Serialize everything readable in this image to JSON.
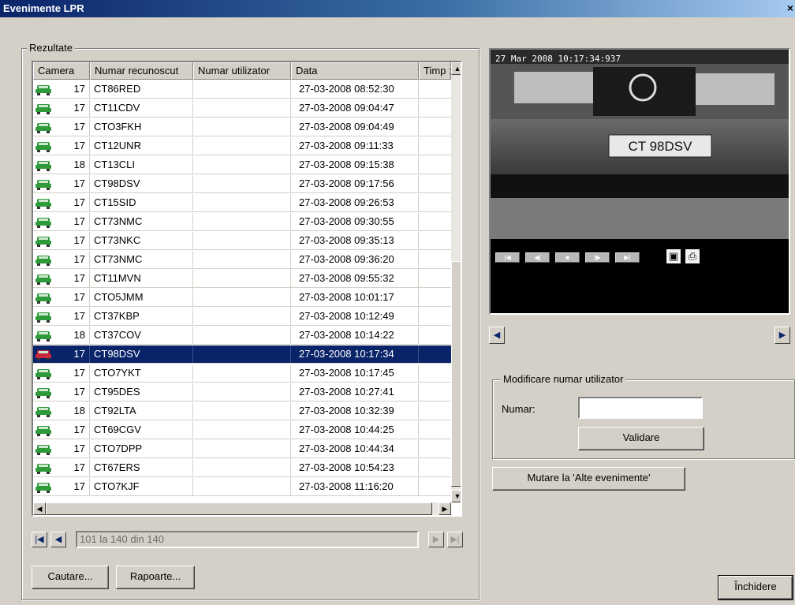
{
  "window": {
    "title": "Evenimente LPR",
    "close_glyph": "×"
  },
  "results": {
    "group_label": "Rezultate",
    "columns": [
      "Camera",
      "Numar recunoscut",
      "Numar utilizator",
      "Data",
      "Timp :"
    ],
    "rows": [
      {
        "camera": "17",
        "plate": "CT86RED",
        "user": "",
        "date": "27-03-2008 08:52:30",
        "icon": "car-icon"
      },
      {
        "camera": "17",
        "plate": "CT11CDV",
        "user": "",
        "date": "27-03-2008 09:04:47",
        "icon": "car-icon"
      },
      {
        "camera": "17",
        "plate": "CTO3FKH",
        "user": "",
        "date": "27-03-2008 09:04:49",
        "icon": "car-icon"
      },
      {
        "camera": "17",
        "plate": "CT12UNR",
        "user": "",
        "date": "27-03-2008 09:11:33",
        "icon": "car-icon"
      },
      {
        "camera": "18",
        "plate": "CT13CLI",
        "user": "",
        "date": "27-03-2008 09:15:38",
        "icon": "car-icon"
      },
      {
        "camera": "17",
        "plate": "CT98DSV",
        "user": "",
        "date": "27-03-2008 09:17:56",
        "icon": "car-icon"
      },
      {
        "camera": "17",
        "plate": "CT15SID",
        "user": "",
        "date": "27-03-2008 09:26:53",
        "icon": "car-icon"
      },
      {
        "camera": "17",
        "plate": "CT73NMC",
        "user": "",
        "date": "27-03-2008 09:30:55",
        "icon": "car-icon"
      },
      {
        "camera": "17",
        "plate": "CT73NKC",
        "user": "",
        "date": "27-03-2008 09:35:13",
        "icon": "car-icon"
      },
      {
        "camera": "17",
        "plate": "CT73NMC",
        "user": "",
        "date": "27-03-2008 09:36:20",
        "icon": "car-icon"
      },
      {
        "camera": "17",
        "plate": "CT11MVN",
        "user": "",
        "date": "27-03-2008 09:55:32",
        "icon": "car-icon"
      },
      {
        "camera": "17",
        "plate": "CTO5JMM",
        "user": "",
        "date": "27-03-2008 10:01:17",
        "icon": "car-icon"
      },
      {
        "camera": "17",
        "plate": "CT37KBP",
        "user": "",
        "date": "27-03-2008 10:12:49",
        "icon": "car-icon"
      },
      {
        "camera": "18",
        "plate": "CT37COV",
        "user": "",
        "date": "27-03-2008 10:14:22",
        "icon": "car-icon"
      },
      {
        "camera": "17",
        "plate": "CT98DSV",
        "user": "",
        "date": "27-03-2008 10:17:34",
        "icon": "car-icon",
        "selected": true
      },
      {
        "camera": "17",
        "plate": "CTO7YKT",
        "user": "",
        "date": "27-03-2008 10:17:45",
        "icon": "car-icon"
      },
      {
        "camera": "17",
        "plate": "CT95DES",
        "user": "",
        "date": "27-03-2008 10:27:41",
        "icon": "car-icon"
      },
      {
        "camera": "18",
        "plate": "CT92LTA",
        "user": "",
        "date": "27-03-2008 10:32:39",
        "icon": "car-icon"
      },
      {
        "camera": "17",
        "plate": "CT69CGV",
        "user": "",
        "date": "27-03-2008 10:44:25",
        "icon": "car-icon"
      },
      {
        "camera": "17",
        "plate": "CTO7DPP",
        "user": "",
        "date": "27-03-2008 10:44:34",
        "icon": "car-icon"
      },
      {
        "camera": "17",
        "plate": "CT67ERS",
        "user": "",
        "date": "27-03-2008 10:54:23",
        "icon": "car-icon"
      },
      {
        "camera": "17",
        "plate": "CTO7KJF",
        "user": "",
        "date": "27-03-2008 11:16:20",
        "icon": "car-icon"
      }
    ],
    "pagination_text": "101 la 140 din 140",
    "search_button": "Cautare...",
    "reports_button": "Rapoarte..."
  },
  "viewer": {
    "timestamp": "27 Mar 2008 10:17:34:937",
    "plate_in_image": "CT 98DSV"
  },
  "modify": {
    "group_label": "Modificare numar utilizator",
    "field_label": "Numar:",
    "field_value": "",
    "validate_button": "Validare"
  },
  "move_button": "Mutare la 'Alte evenimente'",
  "close_button": "Închidere",
  "colors": {
    "selection": "#0a246a",
    "car_green": "#2e9a3a",
    "car_red": "#c8283c"
  }
}
